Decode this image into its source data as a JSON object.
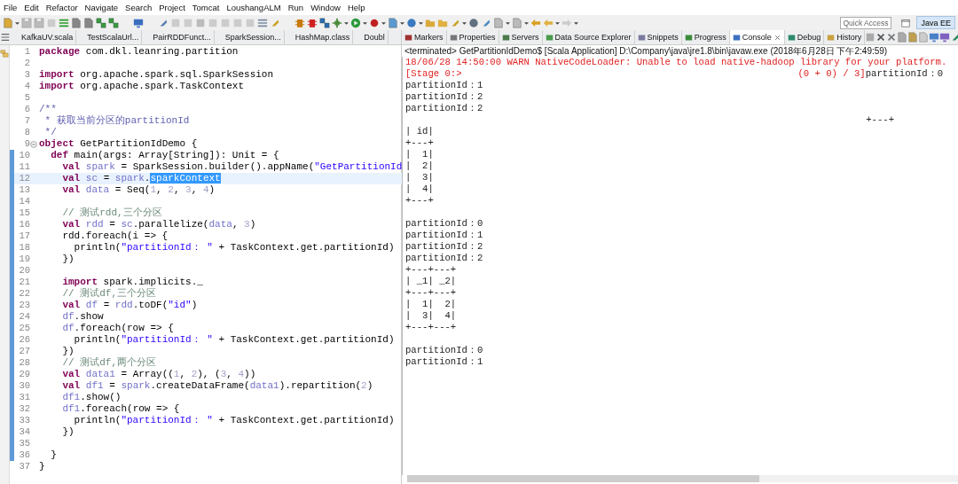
{
  "menu": [
    "File",
    "Edit",
    "Refactor",
    "Navigate",
    "Search",
    "Project",
    "Tomcat",
    "LoushangALM",
    "Run",
    "Window",
    "Help"
  ],
  "toolbar": {
    "quick_access": {
      "placeholder": "Quick Access"
    },
    "perspective": {
      "label": "Java EE",
      "selected": true
    }
  },
  "editor": {
    "tabs": [
      {
        "label": "KafkaUV.scala",
        "selected": false
      },
      {
        "label": "TestScalaUrl...",
        "selected": false
      },
      {
        "label": "PairRDDFunct...",
        "selected": false
      },
      {
        "label": "SparkSession...",
        "selected": false
      },
      {
        "label": "HashMap.class",
        "selected": false
      },
      {
        "label": "Doubl",
        "selected": false
      }
    ],
    "lines": [
      {
        "number": "1",
        "marked": false,
        "current": false,
        "fold": false,
        "tokens": [
          {
            "kind": "kw",
            "text": "package"
          },
          {
            "kind": "p",
            "text": " com.dkl.leanring.partition"
          }
        ]
      },
      {
        "number": "2",
        "marked": false,
        "current": false,
        "fold": false
      },
      {
        "number": "3",
        "marked": false,
        "current": false,
        "fold": false,
        "tokens": [
          {
            "kind": "kw",
            "text": "import"
          },
          {
            "kind": "p",
            "text": " org.apache.spark.sql.SparkSession"
          }
        ]
      },
      {
        "number": "4",
        "marked": false,
        "current": false,
        "fold": false,
        "tokens": [
          {
            "kind": "kw",
            "text": "import"
          },
          {
            "kind": "p",
            "text": " org.apache.spark.TaskContext"
          }
        ]
      },
      {
        "number": "5",
        "marked": false,
        "current": false,
        "fold": false
      },
      {
        "number": "6",
        "marked": false,
        "current": false,
        "fold": false,
        "tokens": [
          {
            "kind": "d",
            "text": "/**"
          }
        ]
      },
      {
        "number": "7",
        "marked": false,
        "current": false,
        "fold": false,
        "tokens": [
          {
            "kind": "d",
            "text": " * 获取当前分区的partitionId"
          }
        ]
      },
      {
        "number": "8",
        "marked": false,
        "current": false,
        "fold": false,
        "tokens": [
          {
            "kind": "d",
            "text": " */"
          }
        ]
      },
      {
        "number": "9",
        "marked": false,
        "current": false,
        "fold": true,
        "tokens": [
          {
            "kind": "kw",
            "text": "object"
          },
          {
            "kind": "p",
            "text": " GetPartitionIdDemo {"
          }
        ]
      },
      {
        "number": "10",
        "marked": true,
        "current": false,
        "fold": false,
        "tokens": [
          {
            "kind": "kw",
            "text": "  def"
          },
          {
            "kind": "p",
            "text": " main(args: Array[String]): Unit = {"
          }
        ]
      },
      {
        "number": "11",
        "marked": true,
        "current": false,
        "fold": false,
        "tokens": [
          {
            "kind": "kw",
            "text": "    val"
          },
          {
            "kind": "f",
            "text": " spark"
          },
          {
            "kind": "p",
            "text": " = SparkSession.builder().appName("
          },
          {
            "kind": "s",
            "text": "\"GetPartitionId"
          }
        ]
      },
      {
        "number": "12",
        "marked": true,
        "current": true,
        "fold": false,
        "tokens": [
          {
            "kind": "kw",
            "text": "    val"
          },
          {
            "kind": "f",
            "text": " sc"
          },
          {
            "kind": "p",
            "text": " = "
          },
          {
            "kind": "f",
            "text": "spark"
          },
          {
            "kind": "p",
            "text": "."
          },
          {
            "kind": "sel",
            "text": "sparkContext"
          }
        ]
      },
      {
        "number": "13",
        "marked": true,
        "current": false,
        "fold": false,
        "tokens": [
          {
            "kind": "kw",
            "text": "    val"
          },
          {
            "kind": "f",
            "text": " data"
          },
          {
            "kind": "p",
            "text": " = Seq("
          },
          {
            "kind": "n",
            "text": "1"
          },
          {
            "kind": "p",
            "text": ", "
          },
          {
            "kind": "n",
            "text": "2"
          },
          {
            "kind": "p",
            "text": ", "
          },
          {
            "kind": "n",
            "text": "3"
          },
          {
            "kind": "p",
            "text": ", "
          },
          {
            "kind": "n",
            "text": "4"
          },
          {
            "kind": "p",
            "text": ")"
          }
        ]
      },
      {
        "number": "14",
        "marked": true,
        "current": false,
        "fold": false
      },
      {
        "number": "15",
        "marked": true,
        "current": false,
        "fold": false,
        "tokens": [
          {
            "kind": "c",
            "text": "    // 测试rdd,三个分区"
          }
        ]
      },
      {
        "number": "16",
        "marked": true,
        "current": false,
        "fold": false,
        "tokens": [
          {
            "kind": "kw",
            "text": "    val"
          },
          {
            "kind": "f",
            "text": " rdd"
          },
          {
            "kind": "p",
            "text": " = "
          },
          {
            "kind": "f",
            "text": "sc"
          },
          {
            "kind": "p",
            "text": ".parallelize("
          },
          {
            "kind": "f",
            "text": "data"
          },
          {
            "kind": "p",
            "text": ", "
          },
          {
            "kind": "n",
            "text": "3"
          },
          {
            "kind": "p",
            "text": ")"
          }
        ]
      },
      {
        "number": "17",
        "marked": true,
        "current": false,
        "fold": false,
        "tokens": [
          {
            "kind": "p",
            "text": "    rdd.foreach(i => {"
          }
        ]
      },
      {
        "number": "18",
        "marked": true,
        "current": false,
        "fold": false,
        "tokens": [
          {
            "kind": "p",
            "text": "      println("
          },
          {
            "kind": "s",
            "text": "\"partitionId： \""
          },
          {
            "kind": "p",
            "text": " + TaskContext.get.partitionId)"
          }
        ]
      },
      {
        "number": "19",
        "marked": true,
        "current": false,
        "fold": false,
        "tokens": [
          {
            "kind": "p",
            "text": "    })"
          }
        ]
      },
      {
        "number": "20",
        "marked": true,
        "current": false,
        "fold": false
      },
      {
        "number": "21",
        "marked": true,
        "current": false,
        "fold": false,
        "tokens": [
          {
            "kind": "kw",
            "text": "    import"
          },
          {
            "kind": "p",
            "text": " spark.implicits._"
          }
        ]
      },
      {
        "number": "22",
        "marked": true,
        "current": false,
        "fold": false,
        "tokens": [
          {
            "kind": "c",
            "text": "    // 测试df,三个分区"
          }
        ]
      },
      {
        "number": "23",
        "marked": true,
        "current": false,
        "fold": false,
        "tokens": [
          {
            "kind": "kw",
            "text": "    val"
          },
          {
            "kind": "f",
            "text": " df"
          },
          {
            "kind": "p",
            "text": " = "
          },
          {
            "kind": "f",
            "text": "rdd"
          },
          {
            "kind": "p",
            "text": ".toDF("
          },
          {
            "kind": "s",
            "text": "\"id\""
          },
          {
            "kind": "p",
            "text": ")"
          }
        ]
      },
      {
        "number": "24",
        "marked": true,
        "current": false,
        "fold": false,
        "tokens": [
          {
            "kind": "f",
            "text": "    df"
          },
          {
            "kind": "p",
            "text": ".show"
          }
        ]
      },
      {
        "number": "25",
        "marked": true,
        "current": false,
        "fold": false,
        "tokens": [
          {
            "kind": "f",
            "text": "    df"
          },
          {
            "kind": "p",
            "text": ".foreach(row => {"
          }
        ]
      },
      {
        "number": "26",
        "marked": true,
        "current": false,
        "fold": false,
        "tokens": [
          {
            "kind": "p",
            "text": "      println("
          },
          {
            "kind": "s",
            "text": "\"partitionId： \""
          },
          {
            "kind": "p",
            "text": " + TaskContext.get.partitionId)"
          }
        ]
      },
      {
        "number": "27",
        "marked": true,
        "current": false,
        "fold": false,
        "tokens": [
          {
            "kind": "p",
            "text": "    })"
          }
        ]
      },
      {
        "number": "28",
        "marked": true,
        "current": false,
        "fold": false,
        "tokens": [
          {
            "kind": "c",
            "text": "    // 测试df,两个分区"
          }
        ]
      },
      {
        "number": "29",
        "marked": true,
        "current": false,
        "fold": false,
        "tokens": [
          {
            "kind": "kw",
            "text": "    val"
          },
          {
            "kind": "f",
            "text": " data1"
          },
          {
            "kind": "p",
            "text": " = Array(("
          },
          {
            "kind": "n",
            "text": "1"
          },
          {
            "kind": "p",
            "text": ", "
          },
          {
            "kind": "n",
            "text": "2"
          },
          {
            "kind": "p",
            "text": "), ("
          },
          {
            "kind": "n",
            "text": "3"
          },
          {
            "kind": "p",
            "text": ", "
          },
          {
            "kind": "n",
            "text": "4"
          },
          {
            "kind": "p",
            "text": "))"
          }
        ]
      },
      {
        "number": "30",
        "marked": true,
        "current": false,
        "fold": false,
        "tokens": [
          {
            "kind": "kw",
            "text": "    val"
          },
          {
            "kind": "f",
            "text": " df1"
          },
          {
            "kind": "p",
            "text": " = "
          },
          {
            "kind": "f",
            "text": "spark"
          },
          {
            "kind": "p",
            "text": ".createDataFrame("
          },
          {
            "kind": "f",
            "text": "data1"
          },
          {
            "kind": "p",
            "text": ").repartition("
          },
          {
            "kind": "n",
            "text": "2"
          },
          {
            "kind": "p",
            "text": ")"
          }
        ]
      },
      {
        "number": "31",
        "marked": true,
        "current": false,
        "fold": false,
        "tokens": [
          {
            "kind": "f",
            "text": "    df1"
          },
          {
            "kind": "p",
            "text": ".show()"
          }
        ]
      },
      {
        "number": "32",
        "marked": true,
        "current": false,
        "fold": false,
        "tokens": [
          {
            "kind": "f",
            "text": "    df1"
          },
          {
            "kind": "p",
            "text": ".foreach(row => {"
          }
        ]
      },
      {
        "number": "33",
        "marked": true,
        "current": false,
        "fold": false,
        "tokens": [
          {
            "kind": "p",
            "text": "      println("
          },
          {
            "kind": "s",
            "text": "\"partitionId： \""
          },
          {
            "kind": "p",
            "text": " + TaskContext.get.partitionId)"
          }
        ]
      },
      {
        "number": "34",
        "marked": true,
        "current": false,
        "fold": false,
        "tokens": [
          {
            "kind": "p",
            "text": "    })"
          }
        ]
      },
      {
        "number": "35",
        "marked": true,
        "current": false,
        "fold": false
      },
      {
        "number": "36",
        "marked": true,
        "current": false,
        "fold": false,
        "tokens": [
          {
            "kind": "p",
            "text": "  }"
          }
        ]
      },
      {
        "number": "37",
        "marked": false,
        "current": false,
        "fold": false,
        "tokens": [
          {
            "kind": "p",
            "text": "}"
          }
        ]
      }
    ]
  },
  "console": {
    "tabs": [
      {
        "label": "Markers",
        "selected": false
      },
      {
        "label": "Properties",
        "selected": false
      },
      {
        "label": "Servers",
        "selected": false
      },
      {
        "label": "Data Source Explorer",
        "selected": false
      },
      {
        "label": "Snippets",
        "selected": false
      },
      {
        "label": "Progress",
        "selected": false
      },
      {
        "label": "Console",
        "selected": true
      },
      {
        "label": "Debug",
        "selected": false
      },
      {
        "label": "History",
        "selected": false
      }
    ],
    "header": "<terminated> GetPartitionIdDemo$ [Scala Application] D:\\Company\\java\\jre1.8\\bin\\javaw.exe (2018年6月28日 下午2:49:59)",
    "lines": [
      {
        "kind": "text",
        "segments": [
          {
            "kind": "err",
            "text": "18/06/28 14:50:00 WARN NativeCodeLoader: Unable to load native-hadoop library for your platform."
          }
        ]
      },
      {
        "kind": "split",
        "segments": [
          {
            "kind": "err",
            "text": "[Stage 0:>"
          },
          {
            "kind": "err",
            "text": "(0 + 0) / 3]"
          },
          {
            "kind": "out",
            "text": "partitionId：0"
          }
        ]
      },
      {
        "kind": "text",
        "segments": [
          {
            "kind": "out",
            "text": "partitionId：1"
          }
        ]
      },
      {
        "kind": "text",
        "segments": [
          {
            "kind": "out",
            "text": "partitionId：2"
          }
        ]
      },
      {
        "kind": "text",
        "segments": [
          {
            "kind": "out",
            "text": "partitionId：2"
          }
        ]
      },
      {
        "kind": "tail",
        "segments": [
          {
            "kind": "out",
            "text": "+---+"
          }
        ]
      },
      {
        "kind": "text",
        "segments": [
          {
            "kind": "out",
            "text": "| id|"
          }
        ]
      },
      {
        "kind": "text",
        "segments": [
          {
            "kind": "out",
            "text": "+---+"
          }
        ]
      },
      {
        "kind": "text",
        "segments": [
          {
            "kind": "out",
            "text": "|  1|"
          }
        ]
      },
      {
        "kind": "text",
        "segments": [
          {
            "kind": "out",
            "text": "|  2|"
          }
        ]
      },
      {
        "kind": "text",
        "segments": [
          {
            "kind": "out",
            "text": "|  3|"
          }
        ]
      },
      {
        "kind": "text",
        "segments": [
          {
            "kind": "out",
            "text": "|  4|"
          }
        ]
      },
      {
        "kind": "text",
        "segments": [
          {
            "kind": "out",
            "text": "+---+"
          }
        ]
      },
      {
        "kind": "blank"
      },
      {
        "kind": "text",
        "segments": [
          {
            "kind": "out",
            "text": "partitionId：0"
          }
        ]
      },
      {
        "kind": "text",
        "segments": [
          {
            "kind": "out",
            "text": "partitionId：1"
          }
        ]
      },
      {
        "kind": "text",
        "segments": [
          {
            "kind": "out",
            "text": "partitionId：2"
          }
        ]
      },
      {
        "kind": "text",
        "segments": [
          {
            "kind": "out",
            "text": "partitionId：2"
          }
        ]
      },
      {
        "kind": "text",
        "segments": [
          {
            "kind": "out",
            "text": "+---+---+"
          }
        ]
      },
      {
        "kind": "text",
        "segments": [
          {
            "kind": "out",
            "text": "| _1| _2|"
          }
        ]
      },
      {
        "kind": "text",
        "segments": [
          {
            "kind": "out",
            "text": "+---+---+"
          }
        ]
      },
      {
        "kind": "text",
        "segments": [
          {
            "kind": "out",
            "text": "|  1|  2|"
          }
        ]
      },
      {
        "kind": "text",
        "segments": [
          {
            "kind": "out",
            "text": "|  3|  4|"
          }
        ]
      },
      {
        "kind": "text",
        "segments": [
          {
            "kind": "out",
            "text": "+---+---+"
          }
        ]
      },
      {
        "kind": "blank"
      },
      {
        "kind": "text",
        "segments": [
          {
            "kind": "out",
            "text": "partitionId：0"
          }
        ]
      },
      {
        "kind": "text",
        "segments": [
          {
            "kind": "out",
            "text": "partitionId：1"
          }
        ]
      }
    ]
  }
}
